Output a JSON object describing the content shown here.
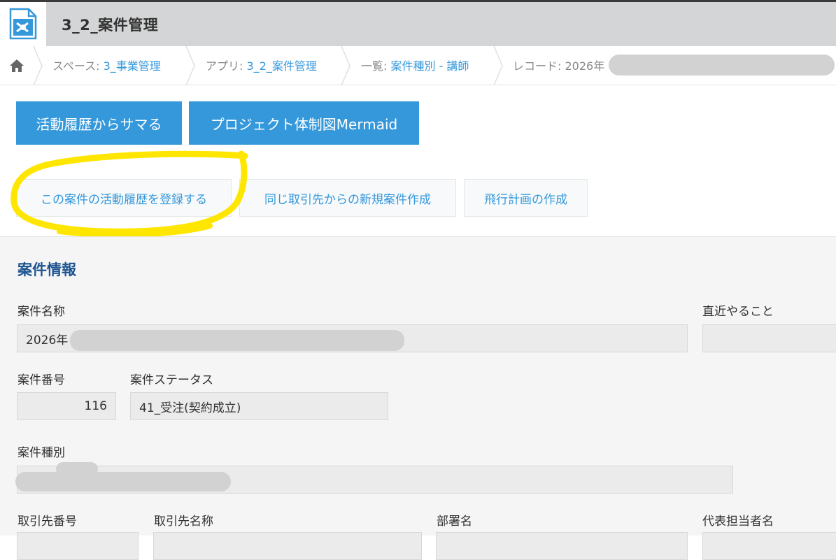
{
  "app": {
    "title": "3_2_案件管理",
    "icon": "app-icon"
  },
  "breadcrumb": {
    "space_label": "スペース: ",
    "space_value": "3_事業管理",
    "app_label": "アプリ: ",
    "app_value": "3_2_案件管理",
    "view_label": "一覧: ",
    "view_value": "案件種別 - 講師",
    "record_label": "レコード: 2026年"
  },
  "actions": {
    "primary": [
      "活動履歴からサマる",
      "プロジェクト体制図Mermaid"
    ],
    "secondary": [
      "この案件の活動履歴を登録する",
      "同じ取引先からの新規案件作成",
      "飛行計画の作成"
    ]
  },
  "highlight_color": "#ffe600",
  "accent_color": "#3498db",
  "section": {
    "title": "案件情報"
  },
  "fields": {
    "project_name": {
      "label": "案件名称",
      "value": "2026年"
    },
    "next_todo": {
      "label": "直近やること",
      "value": ""
    },
    "project_number": {
      "label": "案件番号",
      "value": "116"
    },
    "project_status": {
      "label": "案件ステータス",
      "value": "41_受注(契約成立)"
    },
    "project_type": {
      "label": "案件種別",
      "value": ""
    },
    "client_number": {
      "label": "取引先番号"
    },
    "client_name": {
      "label": "取引先名称"
    },
    "department": {
      "label": "部署名"
    },
    "representative": {
      "label": "代表担当者名"
    }
  }
}
